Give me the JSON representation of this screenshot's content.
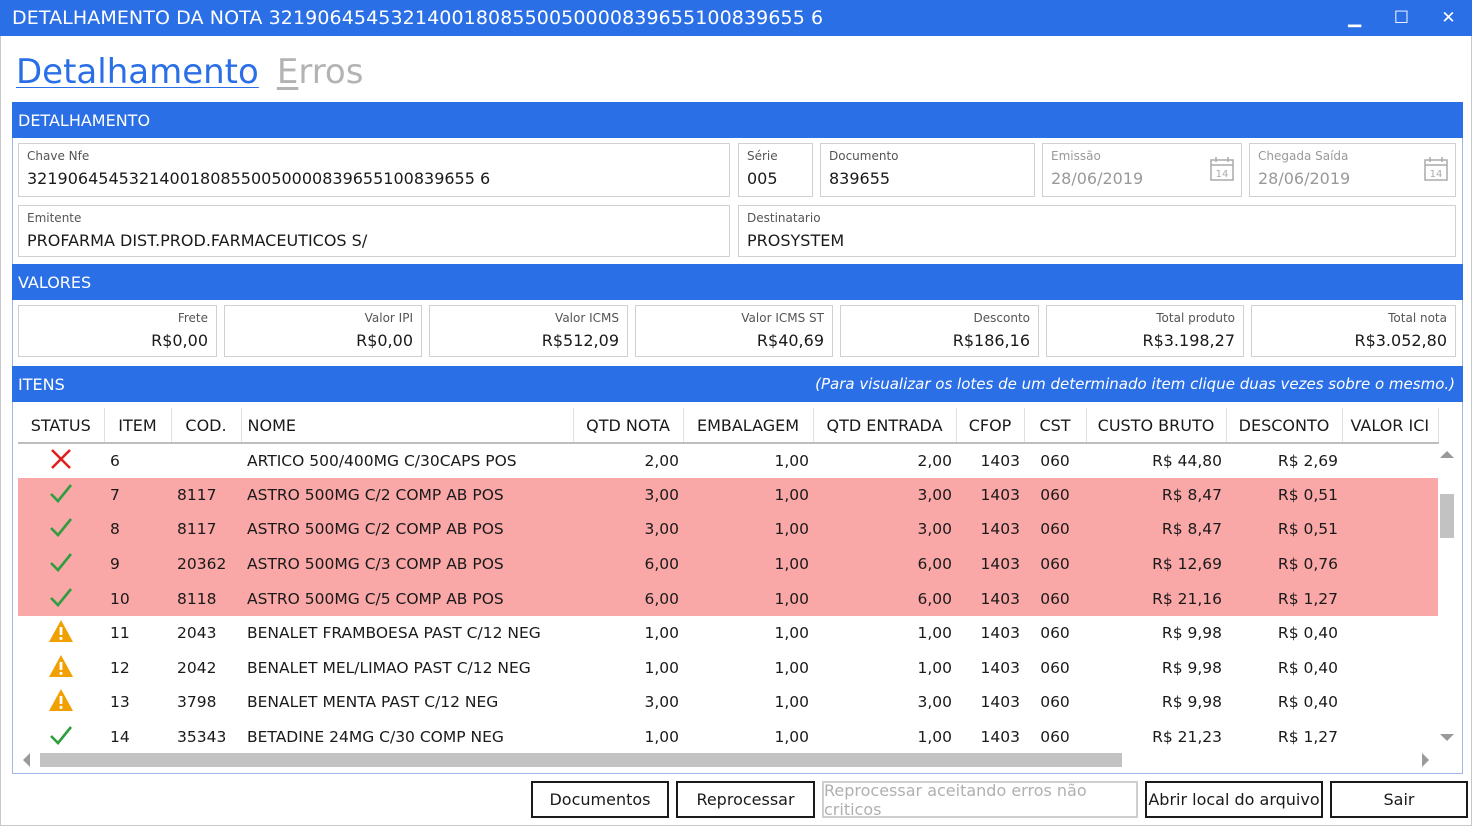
{
  "window": {
    "title": "DETALHAMENTO DA NOTA 32190645453214001808550050000839655100839655 6",
    "min": "▁",
    "max": "☐",
    "close": "✕"
  },
  "tabs": {
    "active": "Detalhamento",
    "inactive_first": "E",
    "inactive_rest": "rros"
  },
  "sections": {
    "detalhamento": "DETALHAMENTO",
    "valores": "VALORES",
    "itens": "ITENS",
    "itens_hint": "(Para visualizar os lotes de um determinado item clique duas vezes sobre o mesmo.)"
  },
  "detalhamento": {
    "chave_label": "Chave Nfe",
    "chave": "32190645453214001808550050000839655100839655 6",
    "serie_label": "Série",
    "serie": "005",
    "documento_label": "Documento",
    "documento": "839655",
    "emissao_label": "Emissão",
    "emissao": "28/06/2019",
    "chegada_label": "Chegada Saída",
    "chegada": "28/06/2019",
    "calendar_day": "14",
    "emitente_label": "Emitente",
    "emitente": "PROFARMA DIST.PROD.FARMACEUTICOS S/",
    "destinatario_label": "Destinatario",
    "destinatario": "PROSYSTEM"
  },
  "valores": [
    {
      "label": "Frete",
      "value": "R$0,00"
    },
    {
      "label": "Valor IPI",
      "value": "R$0,00"
    },
    {
      "label": "Valor ICMS",
      "value": "R$512,09"
    },
    {
      "label": "Valor ICMS ST",
      "value": "R$40,69"
    },
    {
      "label": "Desconto",
      "value": "R$186,16"
    },
    {
      "label": "Total produto",
      "value": "R$3.198,27"
    },
    {
      "label": "Total nota",
      "value": "R$3.052,80"
    }
  ],
  "columns": [
    "STATUS",
    "ITEM",
    "COD.",
    "NOME",
    "QTD NOTA",
    "EMBALAGEM",
    "QTD ENTRADA",
    "CFOP",
    "CST",
    "CUSTO BRUTO",
    "DESCONTO",
    "VALOR ICI"
  ],
  "rows": [
    {
      "status": "error",
      "item": "6",
      "cod": "",
      "nome": "ARTICO 500/400MG C/30CAPS  POS",
      "qtd": "2,00",
      "emb": "1,00",
      "ent": "2,00",
      "cfop": "1403",
      "cst": "060",
      "custo": "R$ 44,80",
      "desc": "R$ 2,69",
      "hl": false
    },
    {
      "status": "ok",
      "item": "7",
      "cod": "8117",
      "nome": "ASTRO 500MG C/2 COMP AB POS",
      "qtd": "3,00",
      "emb": "1,00",
      "ent": "3,00",
      "cfop": "1403",
      "cst": "060",
      "custo": "R$ 8,47",
      "desc": "R$ 0,51",
      "hl": true
    },
    {
      "status": "ok",
      "item": "8",
      "cod": "8117",
      "nome": "ASTRO 500MG C/2 COMP AB POS",
      "qtd": "3,00",
      "emb": "1,00",
      "ent": "3,00",
      "cfop": "1403",
      "cst": "060",
      "custo": "R$ 8,47",
      "desc": "R$ 0,51",
      "hl": true
    },
    {
      "status": "ok",
      "item": "9",
      "cod": "20362",
      "nome": "ASTRO 500MG C/3 COMP AB POS",
      "qtd": "6,00",
      "emb": "1,00",
      "ent": "6,00",
      "cfop": "1403",
      "cst": "060",
      "custo": "R$ 12,69",
      "desc": "R$ 0,76",
      "hl": true
    },
    {
      "status": "ok",
      "item": "10",
      "cod": "8118",
      "nome": "ASTRO 500MG C/5 COMP AB POS",
      "qtd": "6,00",
      "emb": "1,00",
      "ent": "6,00",
      "cfop": "1403",
      "cst": "060",
      "custo": "R$ 21,16",
      "desc": "R$ 1,27",
      "hl": true
    },
    {
      "status": "warn",
      "item": "11",
      "cod": "2043",
      "nome": "BENALET FRAMBOESA PAST C/12  NEG",
      "qtd": "1,00",
      "emb": "1,00",
      "ent": "1,00",
      "cfop": "1403",
      "cst": "060",
      "custo": "R$ 9,98",
      "desc": "R$ 0,40",
      "hl": false
    },
    {
      "status": "warn",
      "item": "12",
      "cod": "2042",
      "nome": "BENALET MEL/LIMAO PAST C/12  NEG",
      "qtd": "1,00",
      "emb": "1,00",
      "ent": "1,00",
      "cfop": "1403",
      "cst": "060",
      "custo": "R$ 9,98",
      "desc": "R$ 0,40",
      "hl": false
    },
    {
      "status": "warn",
      "item": "13",
      "cod": "3798",
      "nome": "BENALET MENTA PAST C/12  NEG",
      "qtd": "3,00",
      "emb": "1,00",
      "ent": "3,00",
      "cfop": "1403",
      "cst": "060",
      "custo": "R$ 9,98",
      "desc": "R$ 0,40",
      "hl": false
    },
    {
      "status": "ok",
      "item": "14",
      "cod": "35343",
      "nome": "BETADINE 24MG C/30 COMP  NEG",
      "qtd": "1,00",
      "emb": "1,00",
      "ent": "1,00",
      "cfop": "1403",
      "cst": "060",
      "custo": "R$ 21,23",
      "desc": "R$ 1,27",
      "hl": false
    }
  ],
  "buttons": {
    "documentos": "Documentos",
    "reprocessar": "Reprocessar",
    "reprocessar_aceitando": "Reprocessar aceitando erros não criticos",
    "abrir_local": "Abrir local do arquivo",
    "sair": "Sair"
  },
  "colors": {
    "accent": "#2b6fe6",
    "highlight_row": "#f9a7a7",
    "ok": "#2e9e3e",
    "error": "#e02020",
    "warn": "#f0a000"
  }
}
